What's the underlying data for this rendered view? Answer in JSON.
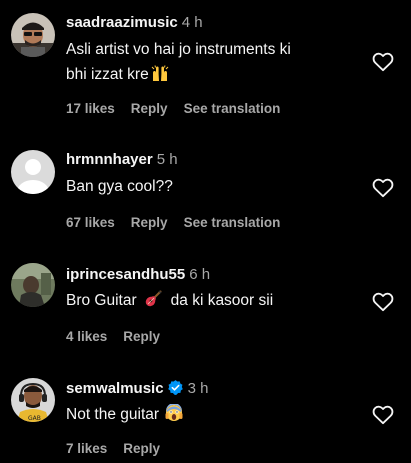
{
  "comments": [
    {
      "username": "saadraazimusic",
      "time": "4 h",
      "verified": false,
      "text_lines": [
        "Asli artist vo hai jo instruments ki",
        "bhi izzat kre"
      ],
      "emoji": "raising-hands",
      "likes": "17 likes",
      "reply": "Reply",
      "translation": "See translation",
      "avatar": "man-with-sunglasses-avatar"
    },
    {
      "username": "hrmnnhayer",
      "time": "5 h",
      "verified": false,
      "text_lines": [
        "Ban gya cool??"
      ],
      "emoji": "",
      "likes": "67 likes",
      "reply": "Reply",
      "translation": "See translation",
      "avatar": "default-avatar"
    },
    {
      "username": "iprincesandhu55",
      "time": "6 h",
      "verified": false,
      "text_lines": [
        "Bro Guitar",
        "da ki kasoor sii"
      ],
      "emoji": "guitar",
      "likes": "4 likes",
      "reply": "Reply",
      "translation": "",
      "avatar": "person-outdoors-avatar"
    },
    {
      "username": "semwalmusic",
      "time": "3 h",
      "verified": true,
      "text_lines": [
        "Not the guitar"
      ],
      "emoji": "screaming-face",
      "likes": "7 likes",
      "reply": "Reply",
      "translation": "",
      "avatar": "man-with-headphones-avatar"
    }
  ],
  "colors": {
    "background": "#000000",
    "primary_text": "#f5f5f5",
    "secondary_text": "#a8a8a8",
    "verified_badge": "#0095f6"
  }
}
